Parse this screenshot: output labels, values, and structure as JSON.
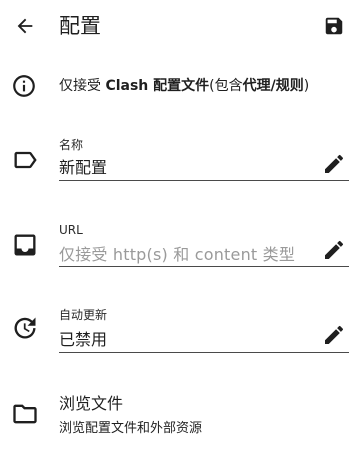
{
  "header": {
    "title": "配置",
    "back_icon": "arrow-back-icon",
    "save_icon": "save-icon"
  },
  "info": {
    "icon": "info-icon",
    "text_before": "仅接受 ",
    "text_bold_1": "Clash 配置文件",
    "text_middle": "(包含",
    "text_bold_2": "代理/规则",
    "text_after": ")"
  },
  "fields": {
    "name": {
      "icon": "label-icon",
      "label": "名称",
      "value": "新配置"
    },
    "url": {
      "icon": "inbox-icon",
      "label": "URL",
      "placeholder": "仅接受 http(s) 和 content 类型"
    },
    "auto_update": {
      "icon": "update-icon",
      "label": "自动更新",
      "value": "已禁用"
    }
  },
  "browse": {
    "icon": "folder-icon",
    "title": "浏览文件",
    "subtitle": "浏览配置文件和外部资源"
  },
  "colors": {
    "text": "#1f1f1f",
    "placeholder": "#9a9a9a",
    "underline": "#4a4a4a",
    "background": "#ffffff"
  }
}
